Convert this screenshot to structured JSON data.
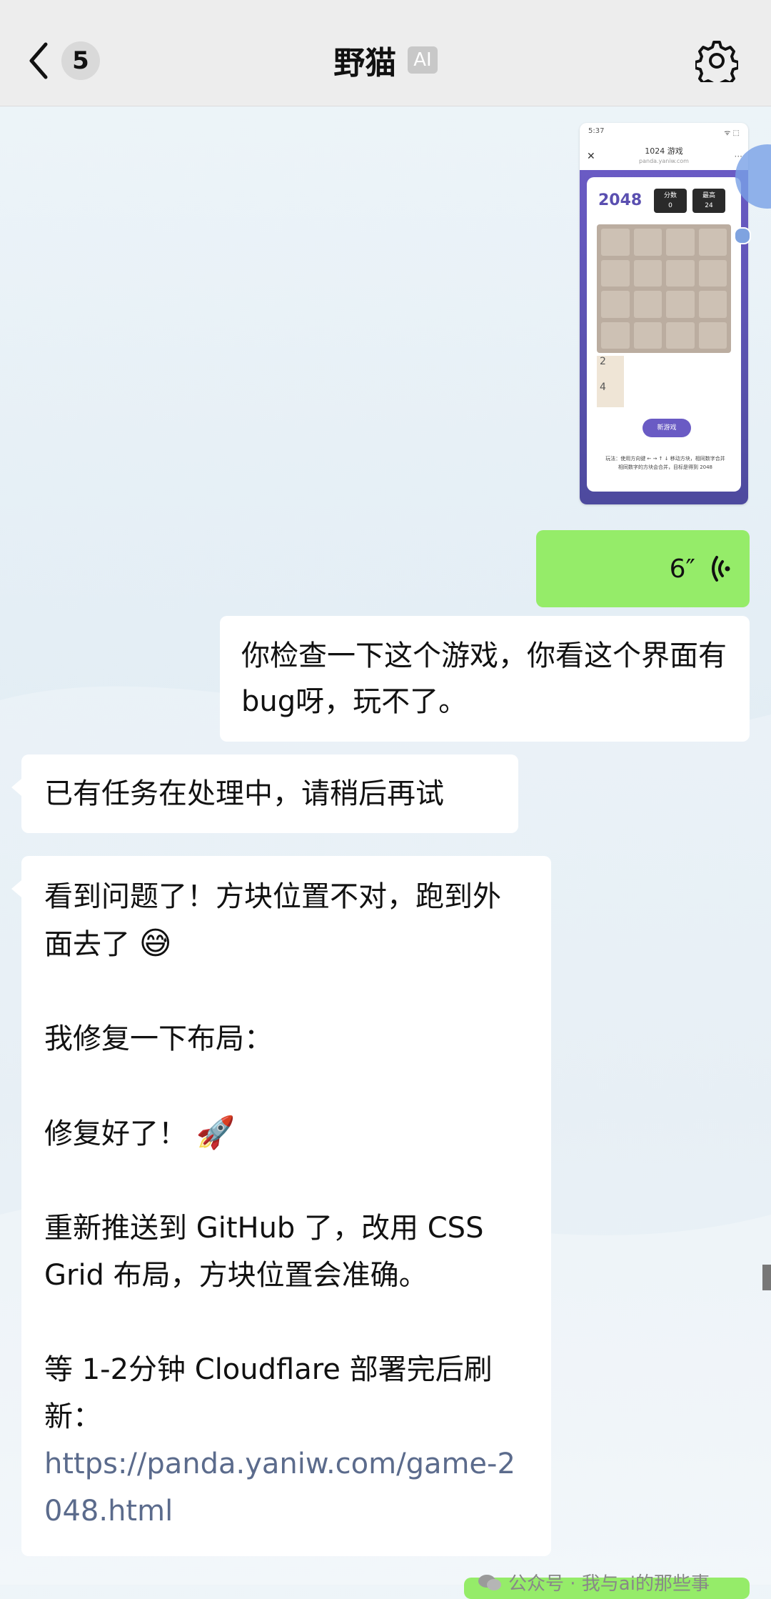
{
  "header": {
    "back_count": "5",
    "title": "野猫",
    "ai_badge": "AI"
  },
  "screenshot_thumb": {
    "status_time": "5:37",
    "status_right": "ᯤ ⬚",
    "page_title": "1024 游戏",
    "page_url": "panda.yaniw.com",
    "game_title": "2048",
    "score_label": "分数",
    "score_value": "0",
    "best_label": "最高",
    "best_value": "24",
    "stray_tile_1": "2",
    "stray_tile_2": "4",
    "button_label": "新游戏",
    "footer_line1": "玩法：使用方向键 ← → ↑ ↓ 移动方块，相同数字合并",
    "footer_line2": "相同数字的方块会合并，目标是得到 2048"
  },
  "messages": {
    "voice_duration": "6″",
    "user_text": "你检查一下这个游戏，你看这个界面有bug呀，玩不了。",
    "bot_busy": "已有任务在处理中，请稍后再试",
    "bot_reply": {
      "line1": "看到问题了！方块位置不对，跑到外面去了",
      "emoji1": "😅",
      "line2": "我修复一下布局：",
      "line3": "修复好了！",
      "emoji2": "🚀",
      "line4": "重新推送到 GitHub 了，改用 CSS Grid 布局，方块位置会准确。",
      "line5": "等 1-2分钟 Cloudflare 部署完后刷新：",
      "link": "https://panda.yaniw.com/game-2048.html"
    }
  },
  "watermark": {
    "text": "公众号 · 我与ai的那些事"
  },
  "colors": {
    "user_bubble": "#95ec69",
    "bot_bubble": "#ffffff",
    "header_bg": "#ededed",
    "link": "#5b6b8c"
  }
}
